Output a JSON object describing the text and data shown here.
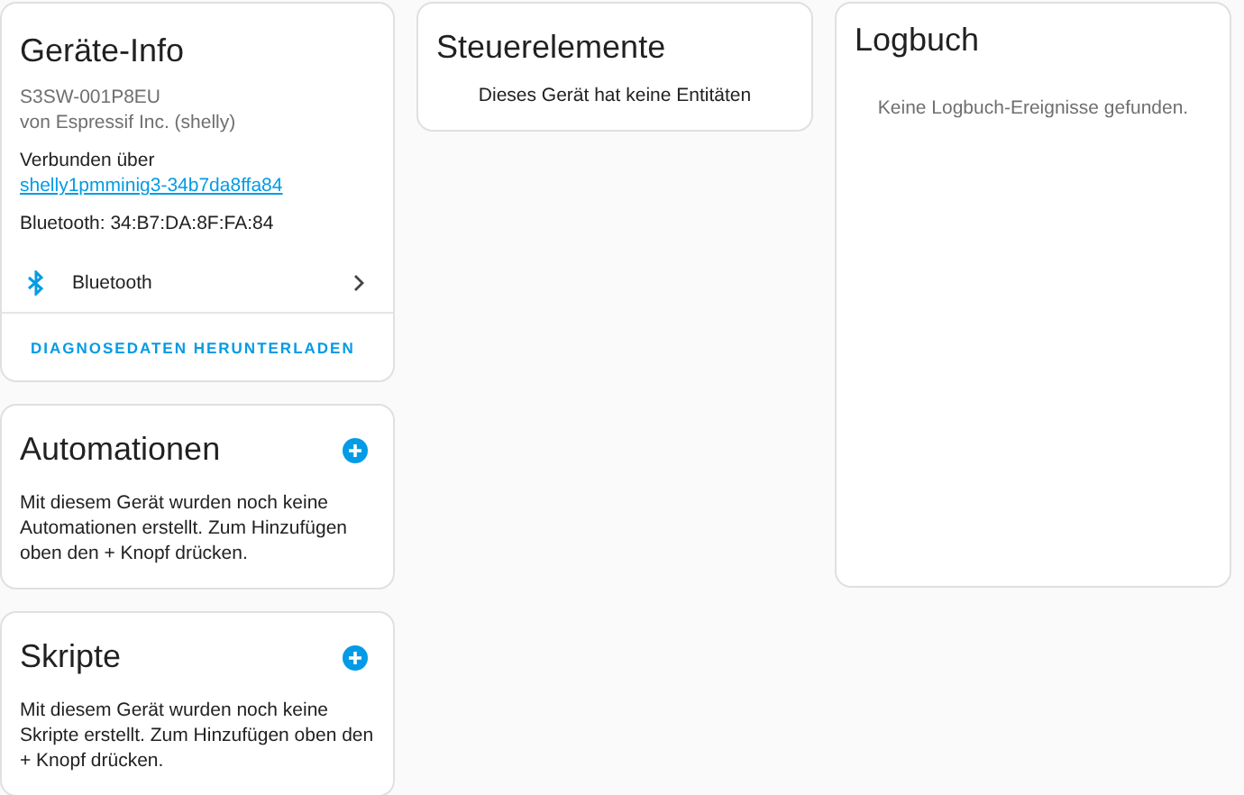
{
  "device_info": {
    "title": "Geräte-Info",
    "model": "S3SW-001P8EU",
    "manufacturer": "von Espressif Inc. (shelly)",
    "connected_label": "Verbunden über",
    "connected_link": "shelly1pmminig3-34b7da8ffa84",
    "bluetooth_address": "Bluetooth: 34:B7:DA:8F:FA:84",
    "integration": "Bluetooth",
    "action": "DIAGNOSEDATEN HERUNTERLADEN"
  },
  "automations": {
    "title": "Automationen",
    "text": "Mit diesem Gerät wurden noch keine Automationen erstellt. Zum Hinzufügen oben den + Knopf drücken."
  },
  "scripts": {
    "title": "Skripte",
    "text": "Mit diesem Gerät wurden noch keine Skripte erstellt. Zum Hinzufügen oben den + Knopf drücken."
  },
  "controls": {
    "title": "Steuerelemente",
    "text": "Dieses Gerät hat keine Entitäten"
  },
  "logbook": {
    "title": "Logbuch",
    "text": "Keine Logbuch-Ereignisse gefunden."
  }
}
